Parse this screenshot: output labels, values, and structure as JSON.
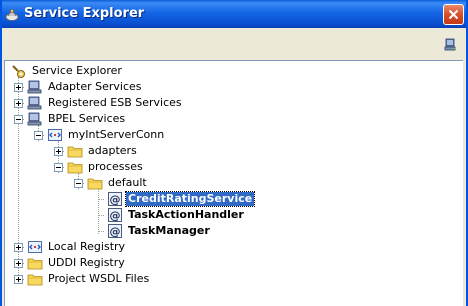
{
  "window": {
    "title": "Service Explorer"
  },
  "icons": {
    "title": "service-explorer-icon",
    "close": "close-icon",
    "refresh": "refresh-icon",
    "root": "key-icon",
    "server": "server-icon",
    "connection": "connection-icon",
    "folder": "folder-icon",
    "service": "web-service-icon"
  },
  "colors": {
    "title_bar": "#0a5fd8",
    "selection": "#316ac5",
    "close_button": "#d9502b"
  },
  "tree": {
    "root": "Service Explorer",
    "adapter_services": "Adapter Services",
    "registered_esb": "Registered ESB Services",
    "bpel_services": "BPEL Services",
    "connection": "myIntServerConn",
    "adapters": "adapters",
    "processes": "processes",
    "default": "default",
    "credit_rating": "CreditRatingService",
    "task_action": "TaskActionHandler",
    "task_manager": "TaskManager",
    "local_registry": "Local Registry",
    "uddi_registry": "UDDI Registry",
    "project_wsdl": "Project WSDL Files"
  }
}
